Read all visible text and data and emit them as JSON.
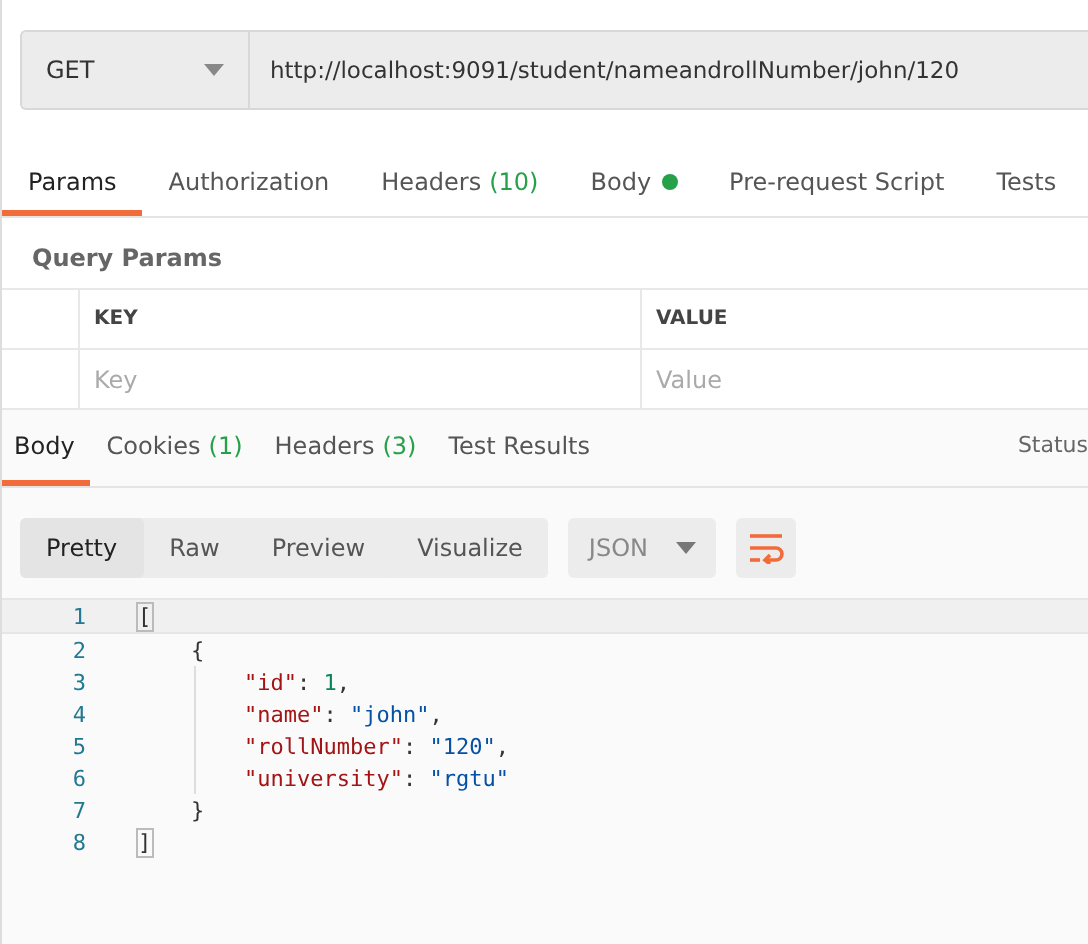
{
  "request": {
    "method": "GET",
    "url": "http://localhost:9091/student/nameandrollNumber/john/120"
  },
  "request_tabs": [
    {
      "label": "Params",
      "selected": true
    },
    {
      "label": "Authorization",
      "selected": false
    },
    {
      "label": "Headers",
      "count": "(10)",
      "selected": false
    },
    {
      "label": "Body",
      "dot": true,
      "selected": false
    },
    {
      "label": "Pre-request Script",
      "selected": false
    },
    {
      "label": "Tests",
      "selected": false
    }
  ],
  "query_params": {
    "title": "Query Params",
    "columns": [
      "KEY",
      "VALUE"
    ],
    "placeholders": [
      "Key",
      "Value"
    ]
  },
  "response_tabs": [
    {
      "label": "Body",
      "selected": true
    },
    {
      "label": "Cookies",
      "count": "(1)",
      "selected": false
    },
    {
      "label": "Headers",
      "count": "(3)",
      "selected": false
    },
    {
      "label": "Test Results",
      "selected": false
    }
  ],
  "status_label": "Status",
  "view_modes": [
    {
      "label": "Pretty",
      "selected": true
    },
    {
      "label": "Raw",
      "selected": false
    },
    {
      "label": "Preview",
      "selected": false
    },
    {
      "label": "Visualize",
      "selected": false
    }
  ],
  "format": "JSON",
  "code_lines": [
    {
      "number": "1",
      "tokens": [
        {
          "kind": "bracket",
          "text": "["
        }
      ]
    },
    {
      "number": "2",
      "tokens": [
        {
          "kind": "punct",
          "text": "    {"
        }
      ]
    },
    {
      "number": "3",
      "tokens": [
        {
          "kind": "key",
          "text": "        \"id\""
        },
        {
          "kind": "punct",
          "text": ": "
        },
        {
          "kind": "number",
          "text": "1"
        },
        {
          "kind": "punct",
          "text": ","
        }
      ]
    },
    {
      "number": "4",
      "tokens": [
        {
          "kind": "key",
          "text": "        \"name\""
        },
        {
          "kind": "punct",
          "text": ": "
        },
        {
          "kind": "string",
          "text": "\"john\""
        },
        {
          "kind": "punct",
          "text": ","
        }
      ]
    },
    {
      "number": "5",
      "tokens": [
        {
          "kind": "key",
          "text": "        \"rollNumber\""
        },
        {
          "kind": "punct",
          "text": ": "
        },
        {
          "kind": "string",
          "text": "\"120\""
        },
        {
          "kind": "punct",
          "text": ","
        }
      ]
    },
    {
      "number": "6",
      "tokens": [
        {
          "kind": "key",
          "text": "        \"university\""
        },
        {
          "kind": "punct",
          "text": ": "
        },
        {
          "kind": "string",
          "text": "\"rgtu\""
        }
      ]
    },
    {
      "number": "7",
      "tokens": [
        {
          "kind": "punct",
          "text": "    }"
        }
      ]
    },
    {
      "number": "8",
      "tokens": [
        {
          "kind": "bracket",
          "text": "]"
        }
      ]
    }
  ]
}
